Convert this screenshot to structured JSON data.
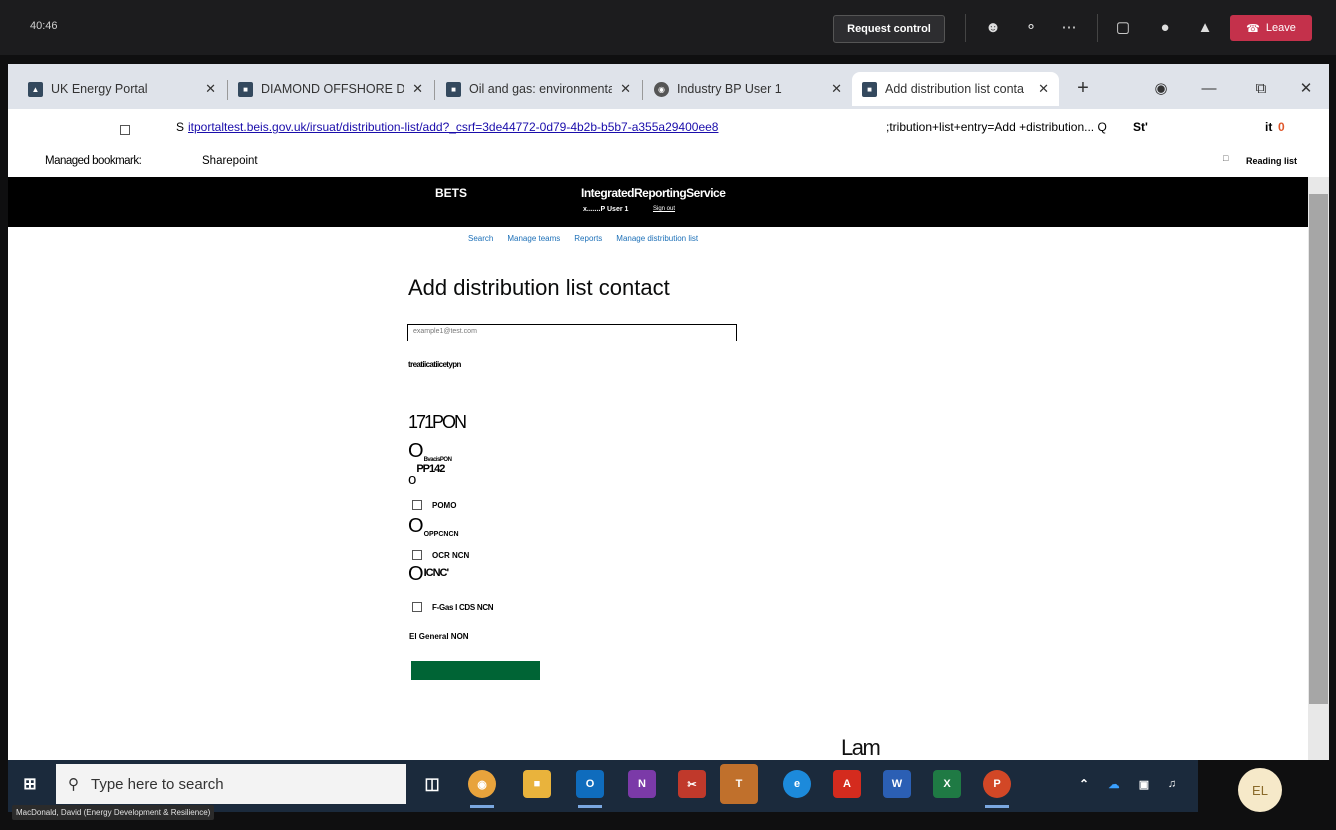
{
  "teams": {
    "timer": "40:46",
    "request_control": "Request control",
    "leave": "Leave",
    "avatar_initials": "EL",
    "presenter_name": "MacDonald, David (Energy Development & Resilience)"
  },
  "browser": {
    "tabs": [
      {
        "label": "UK Energy Portal"
      },
      {
        "label": "DIAMOND OFFSHORE DR"
      },
      {
        "label": "Oil and gas: environmenta"
      },
      {
        "label": "Industry BP User 1"
      },
      {
        "label": "Add distribution list conta"
      }
    ],
    "address_prefix": "S",
    "url": "itportaltest.beis.gov.uk/irsuat/distribution-list/add?_csrf=3de44772-0d79-4b2b-b5b7-a355a29400ee8",
    "url_suffix": ";tribution+list+entry=Add +distribution... Q",
    "url_suffix_bold": "St'",
    "right_text": "it",
    "right_badge": "0",
    "bookmarks_label": "Managed bookmark:",
    "bookmark_item": "Sharepoint",
    "reading_list": "Reading list"
  },
  "site": {
    "brand": "BETS",
    "service": "IntegratedReportingService",
    "user_line": "x.......P User 1",
    "sign_out": "Sign out",
    "nav": [
      "Search",
      "Manage teams",
      "Reports",
      "Manage distribution list"
    ]
  },
  "form": {
    "title": "Add distribution list contact",
    "email_placeholder": "example1@test.com",
    "section_label": "treatiicatiicetypn",
    "big_heading": "171PON",
    "options": [
      {
        "kind": "radio",
        "label": "BvacisPON"
      },
      {
        "kind": "radio",
        "label": "PP142"
      },
      {
        "kind": "checkbox",
        "label": "POMO"
      },
      {
        "kind": "radio",
        "label": "OPPCNCN"
      },
      {
        "kind": "checkbox",
        "label": "OCR NCN"
      },
      {
        "kind": "radio",
        "label": "ICNC'"
      },
      {
        "kind": "checkbox",
        "label": "F-Gas I CDS NCN"
      }
    ],
    "general_label": "El General NON",
    "submit_color": "#006435"
  },
  "overlay_text": "Lam",
  "taskbar": {
    "search_placeholder": "Type here to search"
  }
}
